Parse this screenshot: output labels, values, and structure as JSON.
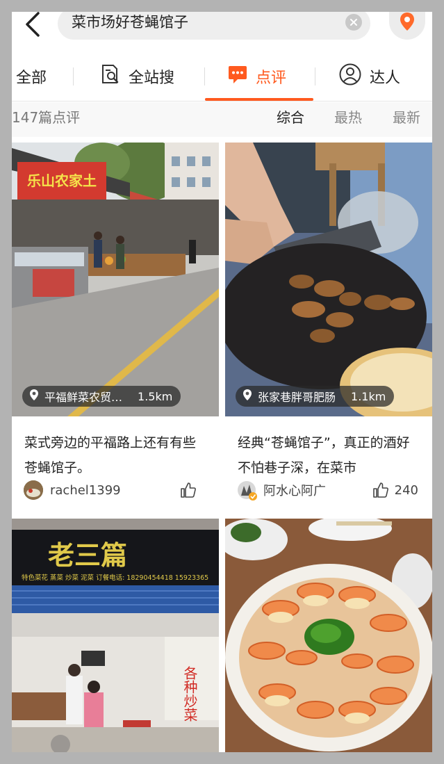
{
  "search": {
    "query": "菜市场好苍蝇馆子"
  },
  "tabs": [
    {
      "label": "全部"
    },
    {
      "label": "全站搜"
    },
    {
      "label": "点评"
    },
    {
      "label": "达人"
    }
  ],
  "review_count": "147篇点评",
  "sort_options": [
    "综合",
    "最热",
    "最新"
  ],
  "cards": [
    {
      "location": "平福鲜菜农贸…",
      "distance": "1.5km",
      "title": "菜式旁边的平福路上还有有些苍蝇馆子。",
      "user": "rachel1399",
      "likes": ""
    },
    {
      "location": "张家巷胖哥肥肠",
      "distance": "1.1km",
      "title": "经典“苍蝇馆子”，真正的酒好不怕巷子深，在菜市",
      "user": "阿水心阿广",
      "likes": "240"
    },
    {
      "shop_sign": "老三篇",
      "sign_subtext": "特色菜花  蒸菜  炒菜  泥菜  订餐电话: 18290454418  15923365",
      "side_sign": "各种炒菜"
    },
    {}
  ],
  "colors": {
    "accent": "#ff5a1f",
    "background": "#b3b3b3"
  }
}
